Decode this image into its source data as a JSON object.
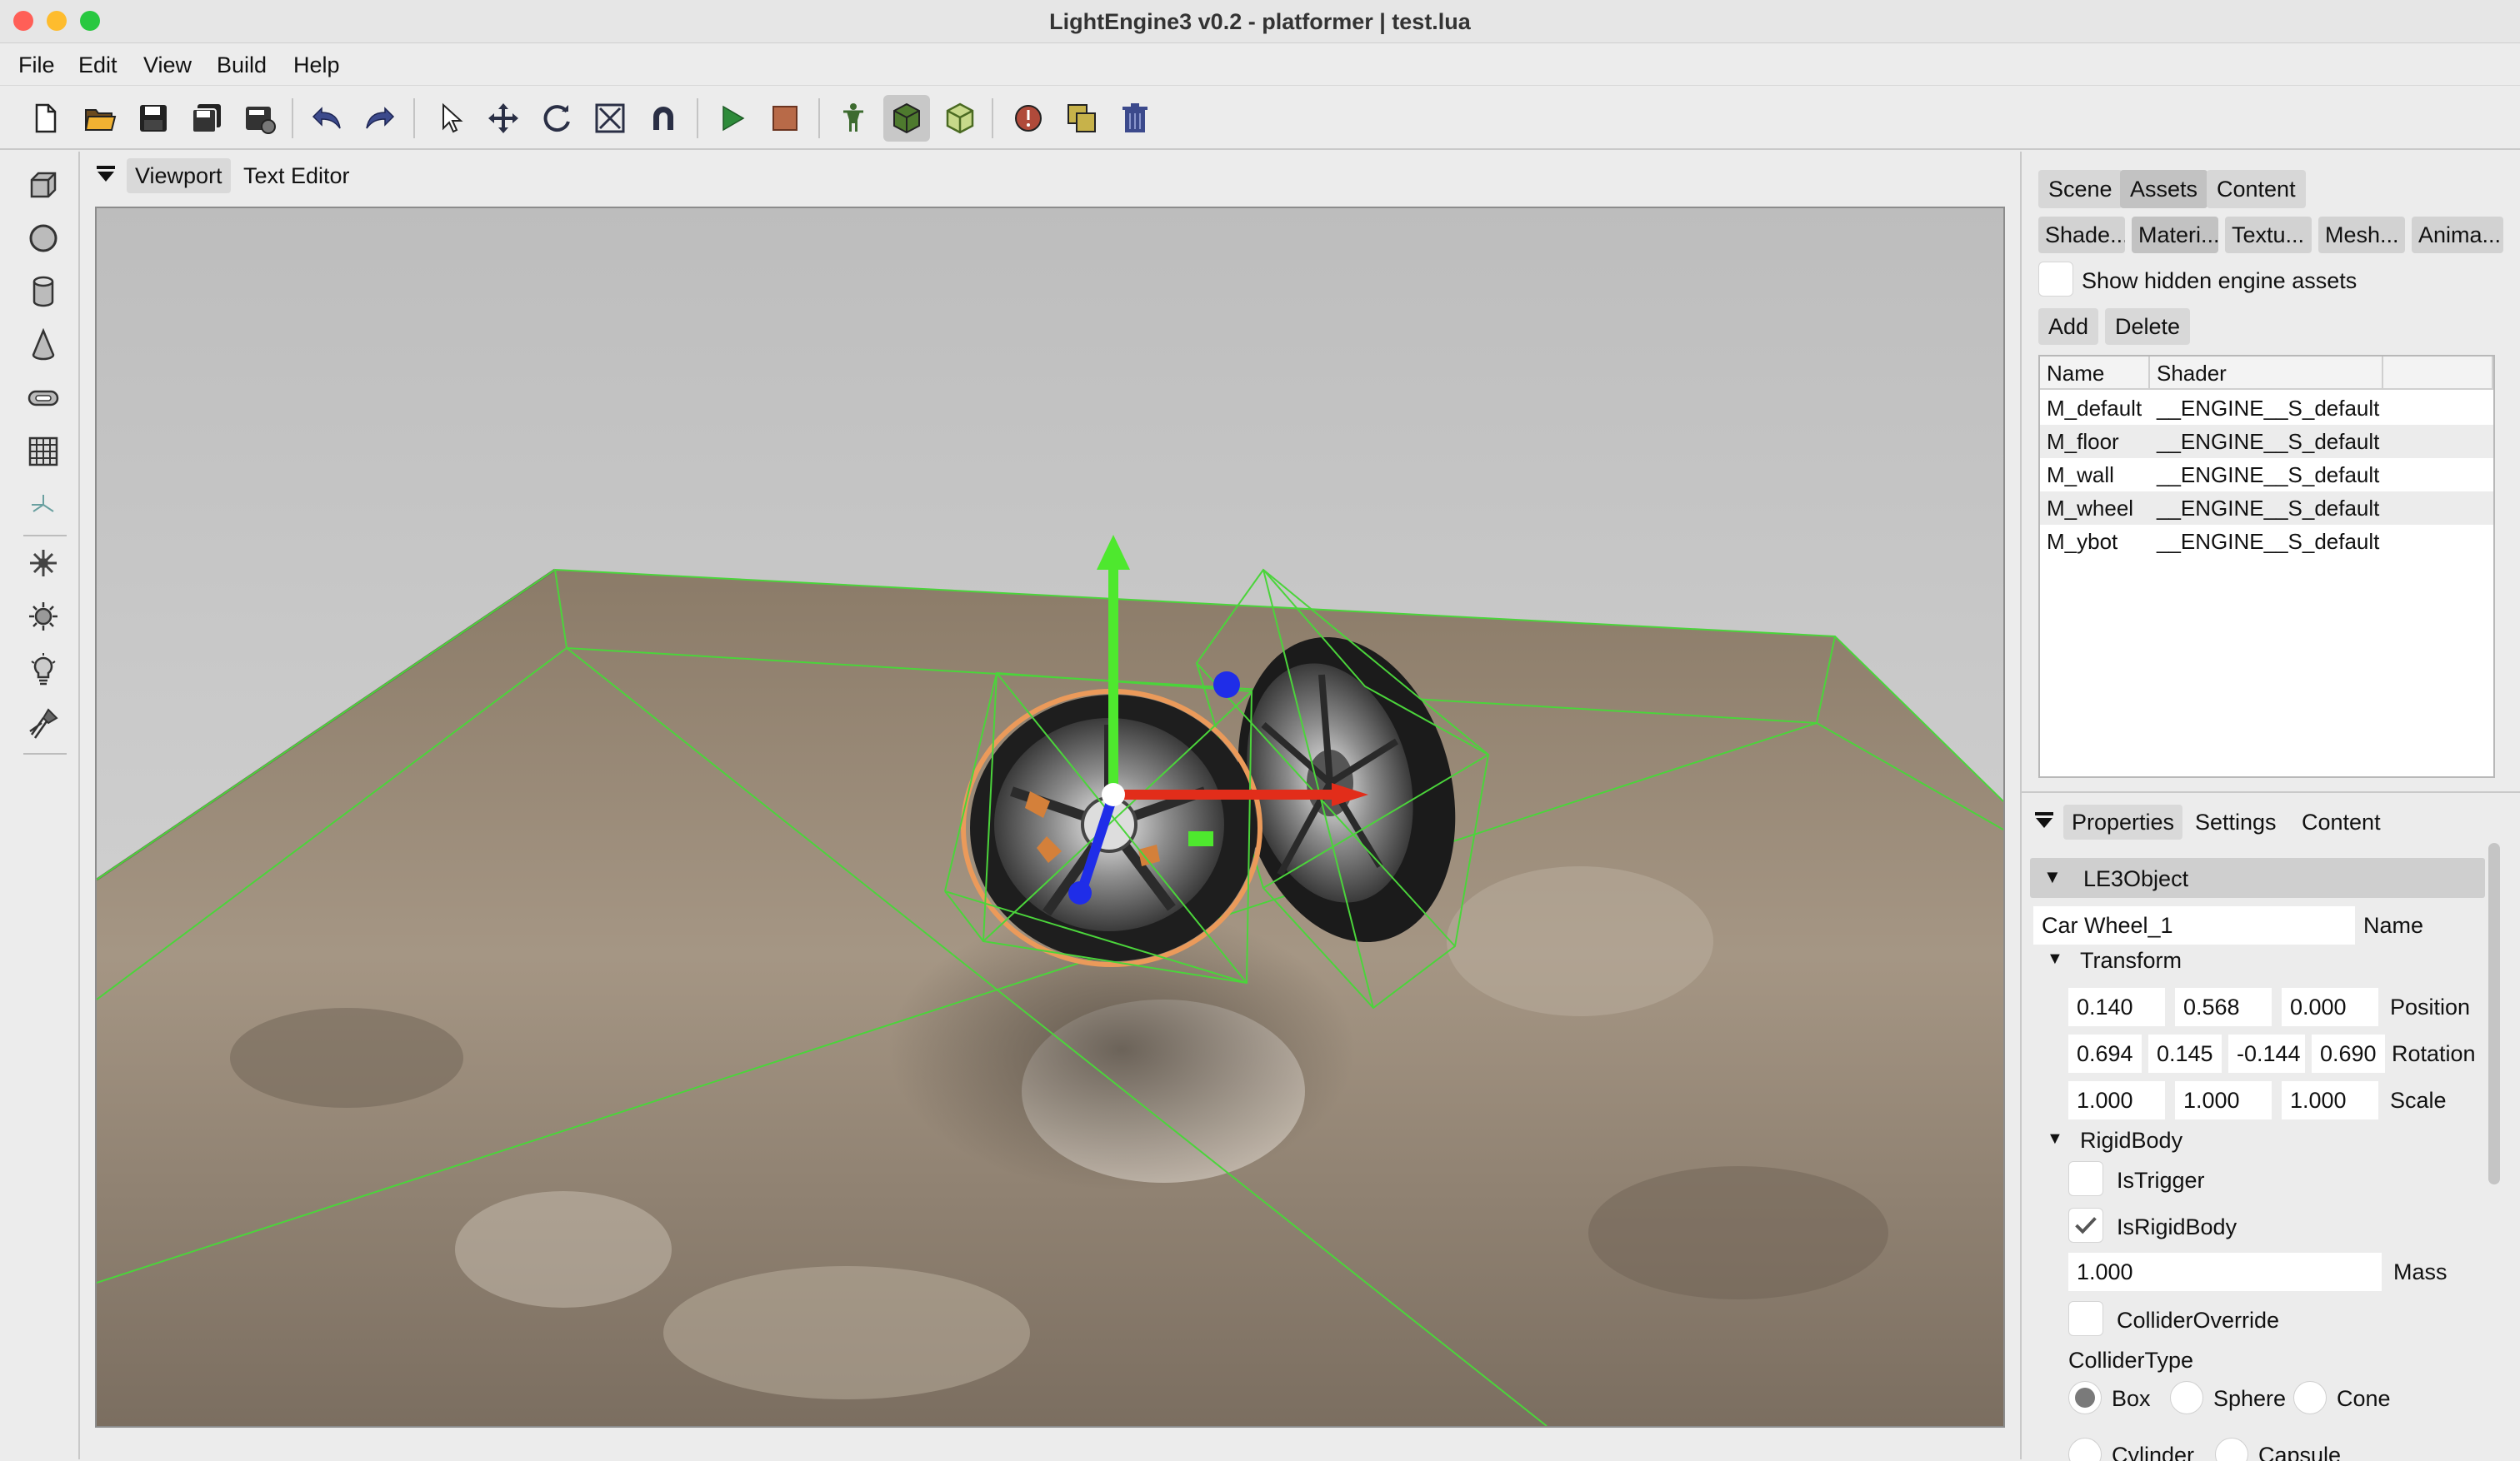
{
  "window": {
    "title": "LightEngine3 v0.2 - platformer | test.lua",
    "traffic_lights": {
      "close": "#ff5f57",
      "minimize": "#febc2e",
      "maximize": "#28c840"
    }
  },
  "menubar": {
    "items": [
      "File",
      "Edit",
      "View",
      "Build",
      "Help"
    ]
  },
  "toolbar": {
    "icons": [
      "new-file-icon",
      "open-folder-icon",
      "save-icon",
      "save-all-icon",
      "export-icon",
      "undo-icon",
      "redo-icon",
      "select-cursor-icon",
      "move-icon",
      "rotate-icon",
      "scale-icon",
      "snap-magnet-icon",
      "play-icon",
      "stop-icon",
      "character-icon",
      "cube-solid-icon",
      "cube-wire-icon",
      "info-icon",
      "duplicate-icon",
      "trash-icon"
    ],
    "active": [
      "cube-solid-icon"
    ]
  },
  "left_tools": {
    "icons": [
      "box-primitive-icon",
      "sphere-primitive-icon",
      "cylinder-primitive-icon",
      "cone-primitive-icon",
      "capsule-primitive-icon",
      "grid-primitive-icon",
      "empty-axis-icon",
      "particles-icon",
      "sun-light-icon",
      "bulb-light-icon",
      "spot-light-icon"
    ]
  },
  "viewport_tabs": {
    "items": [
      "Viewport",
      "Text Editor"
    ],
    "active": "Viewport"
  },
  "right_top_tabs": {
    "items": [
      "Scene",
      "Assets",
      "Content"
    ],
    "active": "Assets"
  },
  "asset_subtabs": {
    "items": [
      "Shade...",
      "Materi...",
      "Textu...",
      "Mesh...",
      "Anima..."
    ],
    "active": "Materi..."
  },
  "assets": {
    "show_hidden_label": "Show hidden engine assets",
    "add_label": "Add",
    "delete_label": "Delete",
    "columns": [
      "Name",
      "Shader"
    ],
    "rows": [
      {
        "name": "M_default",
        "shader": "__ENGINE__S_default"
      },
      {
        "name": "M_floor",
        "shader": "__ENGINE__S_default"
      },
      {
        "name": "M_wall",
        "shader": "__ENGINE__S_default"
      },
      {
        "name": "M_wheel",
        "shader": "__ENGINE__S_default"
      },
      {
        "name": "M_ybot",
        "shader": "__ENGINE__S_default"
      }
    ]
  },
  "props_tabs": {
    "items": [
      "Properties",
      "Settings",
      "Content"
    ],
    "active": "Properties"
  },
  "properties": {
    "object_header": "LE3Object",
    "name_value": "Car Wheel_1",
    "name_label": "Name",
    "transform_header": "Transform",
    "position": [
      "0.140",
      "0.568",
      "0.000"
    ],
    "position_label": "Position",
    "rotation": [
      "0.694",
      "0.145",
      "-0.144",
      "0.690"
    ],
    "rotation_label": "Rotation",
    "scale": [
      "1.000",
      "1.000",
      "1.000"
    ],
    "scale_label": "Scale",
    "rigidbody_header": "RigidBody",
    "is_trigger_label": "IsTrigger",
    "is_trigger": false,
    "is_rigidbody_label": "IsRigidBody",
    "is_rigidbody": true,
    "mass_value": "1.000",
    "mass_label": "Mass",
    "collider_override_label": "ColliderOverride",
    "collider_override": false,
    "collider_type_label": "ColliderType",
    "collider_types": [
      "Box",
      "Sphere",
      "Cone",
      "Cylinder",
      "Capsule"
    ],
    "collider_type_selected": "Box"
  }
}
